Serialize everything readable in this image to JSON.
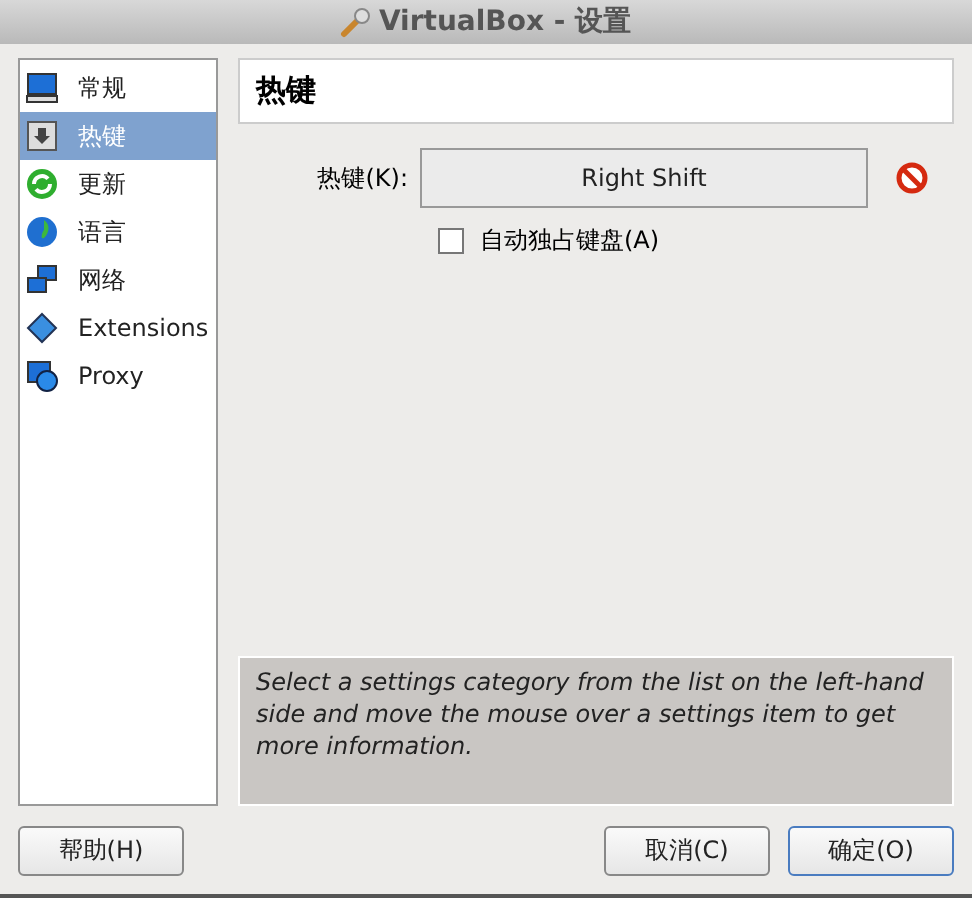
{
  "window": {
    "title": "VirtualBox - 设置"
  },
  "sidebar": {
    "items": [
      {
        "label": "常规",
        "kind": "computer",
        "selected": false
      },
      {
        "label": "热键",
        "kind": "keyboard",
        "selected": true
      },
      {
        "label": "更新",
        "kind": "update",
        "selected": false
      },
      {
        "label": "语言",
        "kind": "globe",
        "selected": false
      },
      {
        "label": "网络",
        "kind": "network",
        "selected": false
      },
      {
        "label": "Extensions",
        "kind": "extension",
        "selected": false
      },
      {
        "label": "Proxy",
        "kind": "proxy",
        "selected": false
      }
    ]
  },
  "page": {
    "title": "热键",
    "hotkey": {
      "label": "热键(K):",
      "value": "Right Shift"
    },
    "capture": {
      "label": "自动独占键盘(A)",
      "checked": false
    }
  },
  "info": "Select a settings category from the list on the left-hand side and move the mouse over a settings item to get more information.",
  "buttons": {
    "help": "帮助(H)",
    "cancel": "取消(C)",
    "ok": "确定(O)"
  }
}
